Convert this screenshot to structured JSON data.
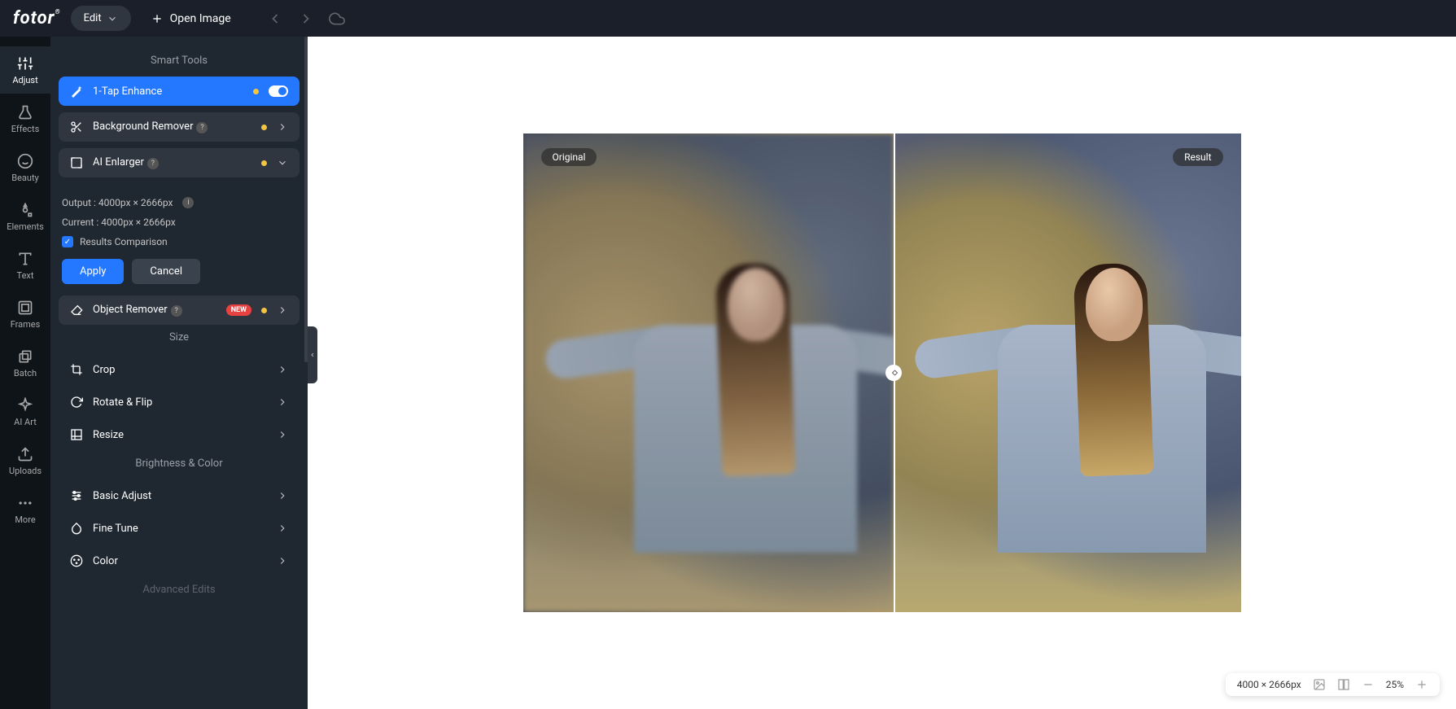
{
  "topbar": {
    "logo": "fotor",
    "edit": "Edit",
    "open": "Open Image"
  },
  "rail": [
    {
      "label": "Adjust"
    },
    {
      "label": "Effects"
    },
    {
      "label": "Beauty"
    },
    {
      "label": "Elements"
    },
    {
      "label": "Text"
    },
    {
      "label": "Frames"
    },
    {
      "label": "Batch"
    },
    {
      "label": "AI Art"
    },
    {
      "label": "Uploads"
    },
    {
      "label": "More"
    }
  ],
  "sections": {
    "smart": "Smart Tools",
    "size": "Size",
    "bright": "Brightness & Color",
    "adv": "Advanced Edits"
  },
  "smart": {
    "enhance": "1-Tap Enhance",
    "bgremove": "Background Remover",
    "enlarger": "AI Enlarger",
    "objremove": "Object Remover",
    "newbadge": "NEW"
  },
  "enlarger": {
    "output": "Output : 4000px × 2666px",
    "current": "Current : 4000px × 2666px",
    "compare": "Results Comparison",
    "apply": "Apply",
    "cancel": "Cancel"
  },
  "sizeTools": {
    "crop": "Crop",
    "rotate": "Rotate & Flip",
    "resize": "Resize"
  },
  "brightTools": {
    "basic": "Basic Adjust",
    "fine": "Fine Tune",
    "color": "Color"
  },
  "canvas": {
    "original": "Original",
    "result": "Result"
  },
  "bottom": {
    "dims": "4000 × 2666px",
    "zoom": "25%"
  }
}
